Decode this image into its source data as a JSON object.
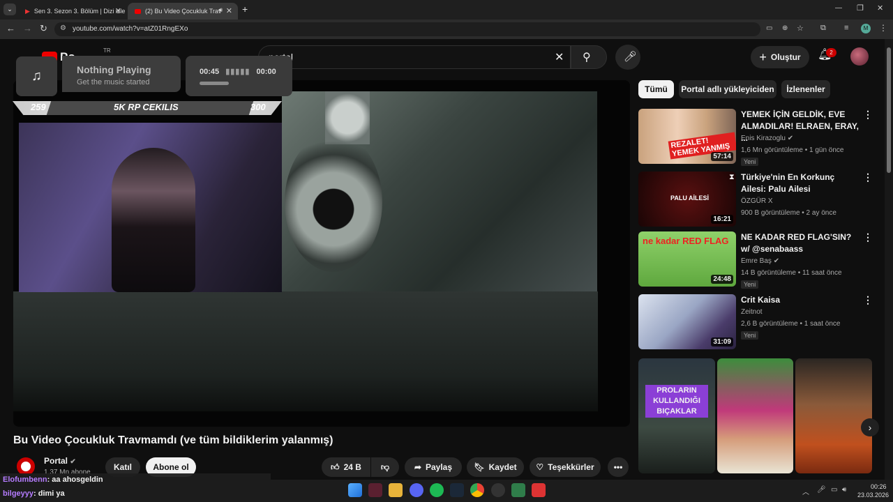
{
  "browser": {
    "tabs": [
      {
        "label": "Sen 3. Sezon 3. Bölüm | Dizi izle"
      },
      {
        "label": "(2) Bu Video Çocukluk Trav"
      }
    ],
    "url": "youtube.com/watch?v=atZ01RngEXo"
  },
  "header": {
    "logo_partial": "Po",
    "country": "TR",
    "search_value": "portal",
    "create_label": "Oluştur",
    "notifications": "2"
  },
  "overlay": {
    "music_title": "Nothing Playing",
    "music_sub": "Get the music started",
    "time_current": "00:45",
    "time_total": "00:00",
    "giveaway_left": "259",
    "giveaway_label": "5K RP CEKILIS",
    "giveaway_right": "300"
  },
  "video": {
    "title": "Bu Video Çocukluk Travmamdı (ve tüm bildiklerim yalanmış)",
    "channel": "Portal",
    "subscribers": "1,37 Mn abone",
    "join_label": "Katıl",
    "subscribe_label": "Abone ol",
    "likes": "24 B",
    "share_label": "Paylaş",
    "save_label": "Kaydet",
    "thanks_label": "Teşekkürler"
  },
  "chips": [
    "Tümü",
    "Portal adlı yükleyiciden",
    "İzlenenler"
  ],
  "recommendations": [
    {
      "title": "YEMEK İÇİN GELDİK, EVE ALMADILAR! ELRAEN, ERAY, ...",
      "channel": "Enis Kirazoglu",
      "meta": "1,6 Mn görüntüleme • 1 gün önce",
      "duration": "57:14",
      "badge": "Yeni",
      "thumb_text": "REZALET! YEMEK YANMIŞ"
    },
    {
      "title": "Türkiye'nin En Korkunç Ailesi: Palu Ailesi",
      "channel": "ÖZGÜR X",
      "meta": "900 B görüntüleme • 2 ay önce",
      "duration": "16:21",
      "badge": "",
      "thumb_text": "PALU AİLESİ"
    },
    {
      "title": "NE KADAR RED FLAG'SIN? w/ @senabaass",
      "channel": "Emre Baş",
      "meta": "14 B görüntüleme • 11 saat önce",
      "duration": "24:48",
      "badge": "Yeni",
      "thumb_text": "ne kadar RED FLAG"
    },
    {
      "title": "Crit Kaisa",
      "channel": "Zeitnot",
      "meta": "2,6 B görüntüleme • 1 saat önce",
      "duration": "31:09",
      "badge": "Yeni",
      "thumb_text": ""
    }
  ],
  "shorts": {
    "first_text": "PROLARIN KULLANDIĞI BIÇAKLAR"
  },
  "chat": [
    {
      "user": "Elofumbenn",
      "text": ": aa ahosgeldin",
      "color": "#b57cff"
    },
    {
      "user": "bilgeyyy",
      "text": ": dimi ya",
      "color": "#b57cff"
    }
  ],
  "tray": {
    "time": "00:26",
    "date": "23.03.2026"
  }
}
